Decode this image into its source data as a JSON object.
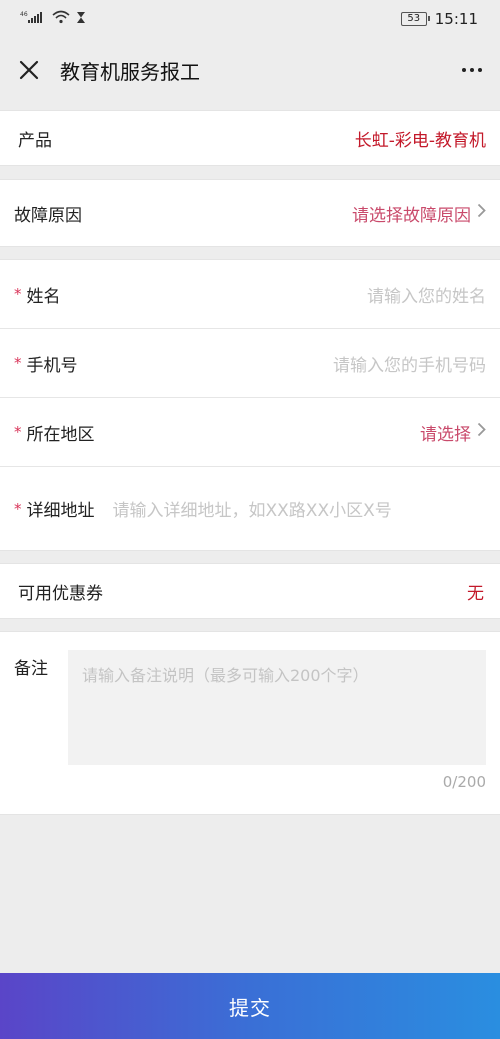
{
  "status": {
    "signal": "46",
    "time": "15:11",
    "battery": "53"
  },
  "nav": {
    "title": "教育机服务报工"
  },
  "product": {
    "label": "产品",
    "value": "长虹-彩电-教育机"
  },
  "fault": {
    "label": "故障原因",
    "value": "请选择故障原因"
  },
  "name": {
    "required": "*",
    "label": "姓名",
    "placeholder": "请输入您的姓名"
  },
  "phone": {
    "required": "*",
    "label": "手机号",
    "placeholder": "请输入您的手机号码"
  },
  "region": {
    "required": "*",
    "label": "所在地区",
    "value": "请选择"
  },
  "address": {
    "required": "*",
    "label": "详细地址",
    "placeholder": "请输入详细地址，如XX路XX小区X号"
  },
  "coupon": {
    "label": "可用优惠券",
    "value": "无"
  },
  "remark": {
    "label": "备注",
    "placeholder": "请输入备注说明（最多可输入200个字）",
    "count": "0/200"
  },
  "submit": {
    "label": "提交"
  }
}
